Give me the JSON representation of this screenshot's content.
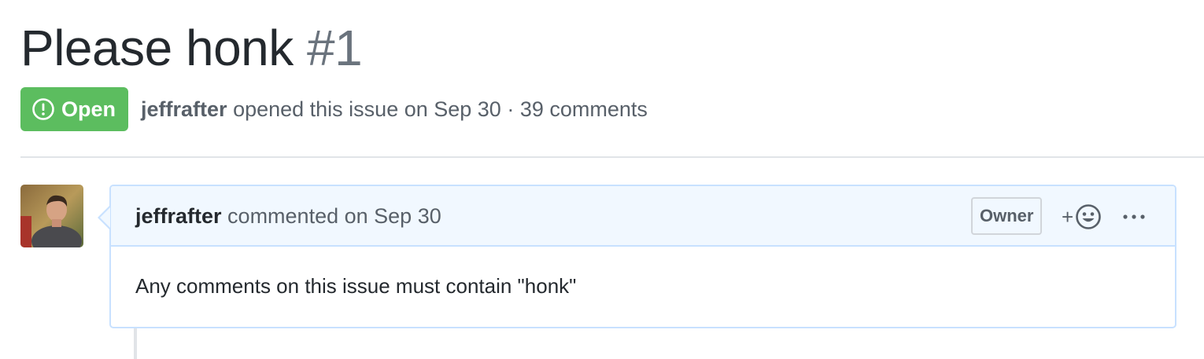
{
  "issue": {
    "title": "Please honk",
    "number": "#1",
    "state": "Open",
    "author": "jeffrafter",
    "opened_text": "opened this issue on Sep 30 · 39 comments"
  },
  "comment": {
    "author": "jeffrafter",
    "action_text": "commented on Sep 30",
    "role_label": "Owner",
    "reaction_plus": "+",
    "body": "Any comments on this issue must contain \"honk\""
  },
  "icons": {
    "state": "issue-opened-icon",
    "reaction": "smiley-icon",
    "more": "kebab-horizontal-icon"
  },
  "colors": {
    "open_badge": "#5cbd5f",
    "comment_border": "#c8e1ff",
    "comment_header_bg": "#f1f8ff"
  }
}
